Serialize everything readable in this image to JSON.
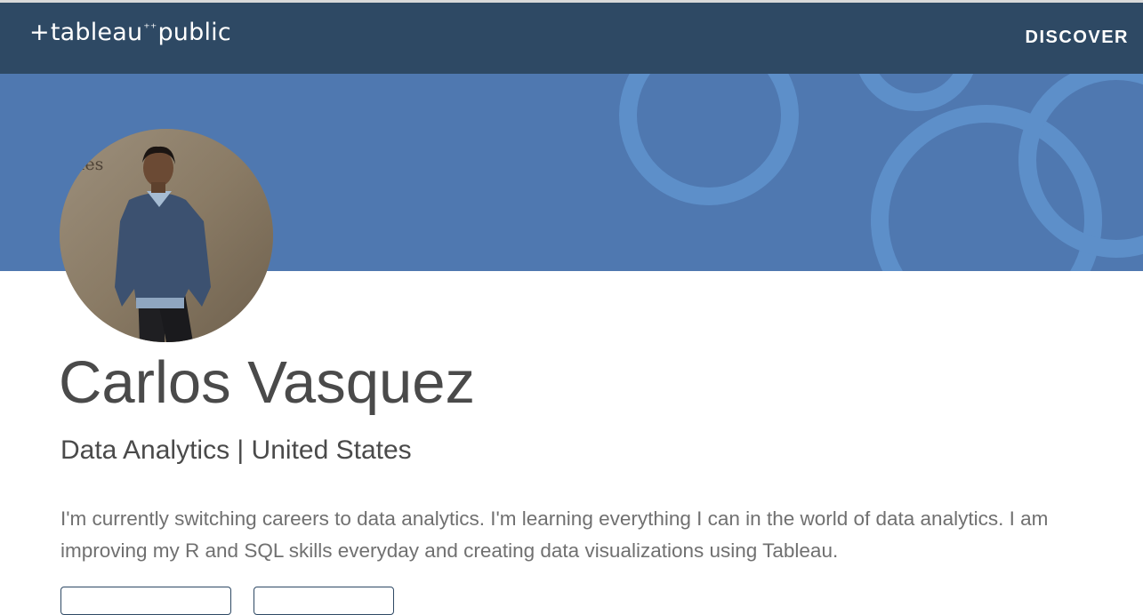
{
  "navbar": {
    "logo_text_left": "tableau",
    "logo_text_right": "public",
    "discover_label": "DISCOVER"
  },
  "profile": {
    "name": "Carlos Vasquez",
    "subtitle": "Data Analytics | United States",
    "bio": "I'm currently switching careers to data analytics. I'm learning everything I can in the world of data analytics. I am improving my R and SQL skills everyday and creating data visualizations using Tableau.",
    "photo_wall_text": "ques"
  },
  "colors": {
    "navbar": "#2e4964",
    "banner": "#4f78b0",
    "banner_ring": "#5d8fc9",
    "name_text": "#4a4a4a",
    "bio_text": "#707070"
  }
}
